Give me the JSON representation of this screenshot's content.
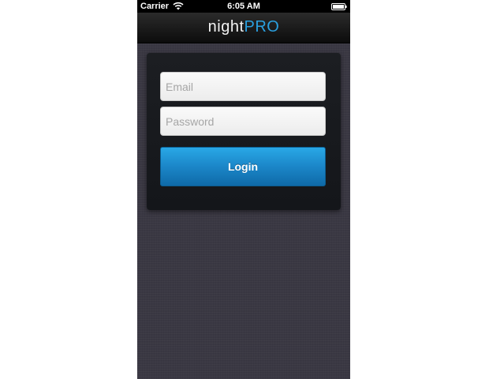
{
  "status_bar": {
    "carrier": "Carrier",
    "time": "6:05 AM",
    "wifi_icon": "wifi-icon",
    "battery_icon": "battery-icon"
  },
  "nav_bar": {
    "brand_night": "night",
    "brand_pro": "PRO"
  },
  "login_form": {
    "email": {
      "value": "",
      "placeholder": "Email"
    },
    "password": {
      "value": "",
      "placeholder": "Password"
    },
    "login_label": "Login"
  },
  "colors": {
    "accent": "#2aa0e0",
    "button": "#1b86c8",
    "background": "#3a3843",
    "card": "#1a1c20"
  }
}
